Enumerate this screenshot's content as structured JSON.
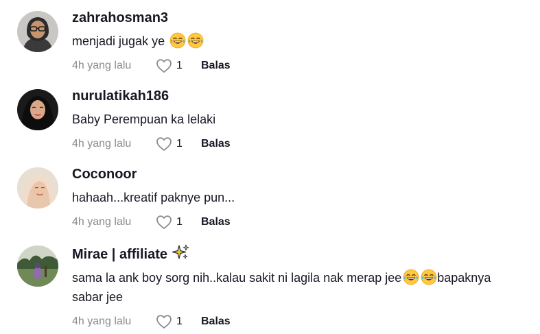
{
  "comments": [
    {
      "username": "zahrahosman3",
      "text": "menjadi jugak ye ",
      "emoji_count": 2,
      "time": "4h yang lalu",
      "likes": "1",
      "reply_label": "Balas",
      "avatar": "avatar-woman-glasses"
    },
    {
      "username": "nurulatikah186",
      "text": "Baby Perempuan ka lelaki",
      "time": "4h yang lalu",
      "likes": "1",
      "reply_label": "Balas",
      "avatar": "avatar-woman-dark-hijab"
    },
    {
      "username": "Coconoor",
      "text": "hahaah...kreatif paknye pun...",
      "time": "4h yang lalu",
      "likes": "1",
      "reply_label": "Balas",
      "avatar": "avatar-woman-light-hijab"
    },
    {
      "username": "Mirae | affiliate",
      "text_part1": "sama la ank boy sorg nih..kalau sakit ni lagila nak merap jee",
      "text_part2": "bapaknya",
      "text_line2": "sabar jee",
      "time": "4h yang lalu",
      "likes": "1",
      "reply_label": "Balas",
      "avatar": "avatar-outdoor-park",
      "badge_icon": "sparkles-icon"
    }
  ],
  "colors": {
    "text_primary": "#161823",
    "text_secondary": "#8a8b91",
    "background": "#ffffff"
  }
}
